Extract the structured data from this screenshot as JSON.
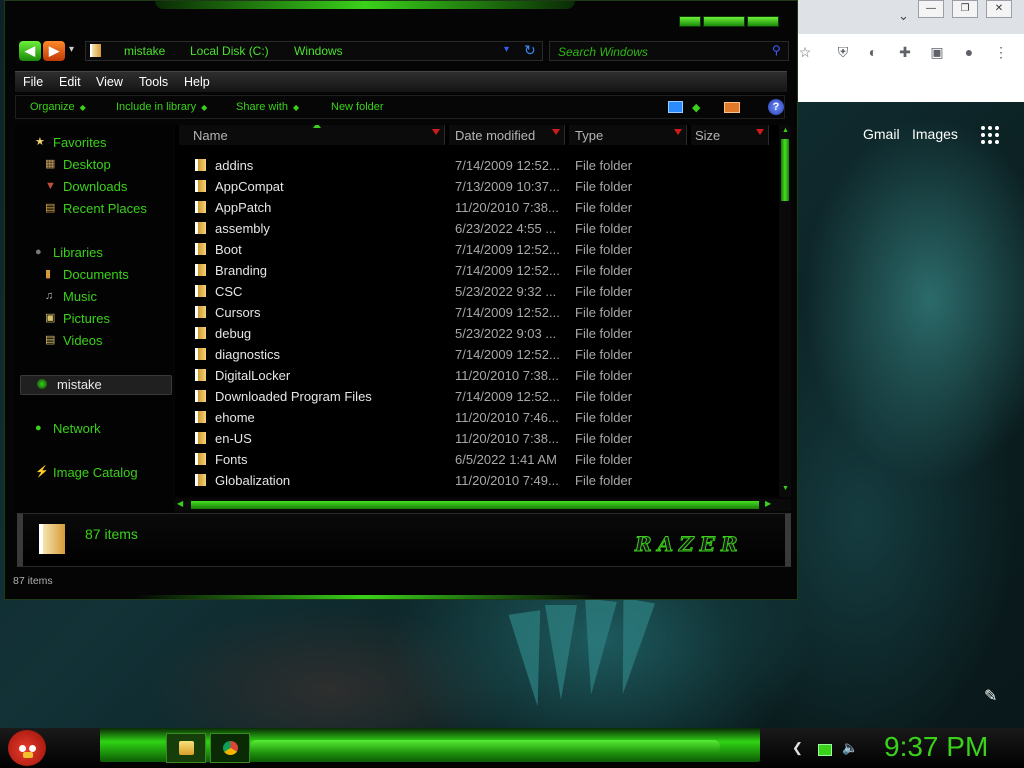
{
  "explorer": {
    "nav": {
      "back_icon": "back-arrow-icon",
      "forward_icon": "forward-arrow-icon"
    },
    "address": [
      "mistake",
      "Local Disk (C:)",
      "Windows"
    ],
    "search_placeholder": "Search Windows",
    "menu": [
      "File",
      "Edit",
      "View",
      "Tools",
      "Help"
    ],
    "commands": [
      "Organize",
      "Include in library",
      "Share with",
      "New folder"
    ],
    "help_label": "?",
    "sidebar": {
      "favorites": "Favorites",
      "favorites_items": [
        "Desktop",
        "Downloads",
        "Recent Places"
      ],
      "libraries": "Libraries",
      "libraries_items": [
        "Documents",
        "Music",
        "Pictures",
        "Videos"
      ],
      "homegroup": "mistake",
      "network": "Network",
      "image_catalog": "Image Catalog"
    },
    "columns": [
      "Name",
      "Date modified",
      "Type",
      "Size"
    ],
    "files": [
      {
        "name": "addins",
        "date": "7/14/2009 12:52...",
        "type": "File folder"
      },
      {
        "name": "AppCompat",
        "date": "7/13/2009 10:37...",
        "type": "File folder"
      },
      {
        "name": "AppPatch",
        "date": "11/20/2010 7:38...",
        "type": "File folder"
      },
      {
        "name": "assembly",
        "date": "6/23/2022 4:55 ...",
        "type": "File folder"
      },
      {
        "name": "Boot",
        "date": "7/14/2009 12:52...",
        "type": "File folder"
      },
      {
        "name": "Branding",
        "date": "7/14/2009 12:52...",
        "type": "File folder"
      },
      {
        "name": "CSC",
        "date": "5/23/2022 9:32 ...",
        "type": "File folder"
      },
      {
        "name": "Cursors",
        "date": "7/14/2009 12:52...",
        "type": "File folder"
      },
      {
        "name": "debug",
        "date": "5/23/2022 9:03 ...",
        "type": "File folder"
      },
      {
        "name": "diagnostics",
        "date": "7/14/2009 12:52...",
        "type": "File folder"
      },
      {
        "name": "DigitalLocker",
        "date": "11/20/2010 7:38...",
        "type": "File folder"
      },
      {
        "name": "Downloaded Program Files",
        "date": "7/14/2009 12:52...",
        "type": "File folder"
      },
      {
        "name": "ehome",
        "date": "11/20/2010 7:46...",
        "type": "File folder"
      },
      {
        "name": "en-US",
        "date": "11/20/2010 7:38...",
        "type": "File folder"
      },
      {
        "name": "Fonts",
        "date": "6/5/2022 1:41 AM",
        "type": "File folder"
      },
      {
        "name": "Globalization",
        "date": "11/20/2010 7:49...",
        "type": "File folder"
      }
    ],
    "item_count": "87 items",
    "status_text": "87 items",
    "brand": "RAZER"
  },
  "browser": {
    "links": [
      "Gmail",
      "Images"
    ]
  },
  "taskbar": {
    "clock": "9:37 PM"
  },
  "colors": {
    "accent": "#3ad11a",
    "sort_arrow": "#d21a1a"
  }
}
